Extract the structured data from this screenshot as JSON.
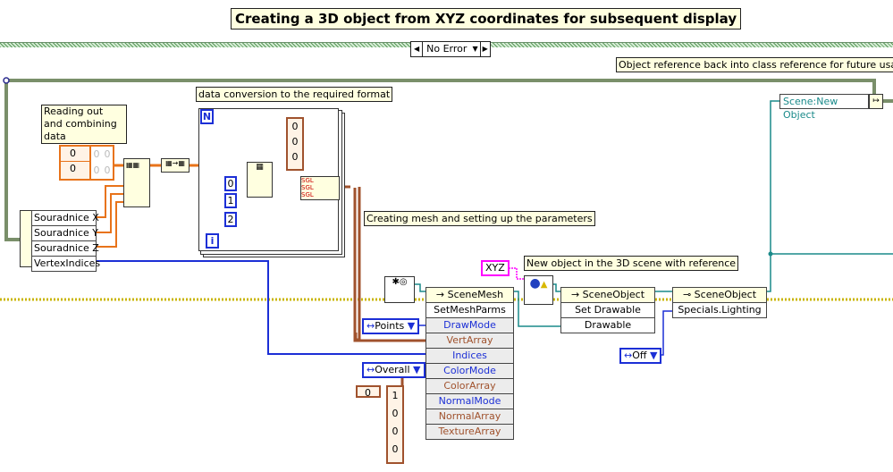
{
  "title": "Creating a 3D object from XYZ coordinates for subsequent display",
  "error_cluster": {
    "value": "No Error"
  },
  "comments": {
    "reading": "Reading out and combining data",
    "conversion": "data conversion to the required format",
    "mesh": "Creating mesh and setting up the parameters",
    "new_object": "New object in the 3D scene with reference",
    "object_ref": "Object reference back into class reference for future usage"
  },
  "unbundle": {
    "items": [
      {
        "label": "Souradnice X",
        "color": "orange"
      },
      {
        "label": "Souradnice Y",
        "color": "orange"
      },
      {
        "label": "Souradnice Z",
        "color": "orange"
      },
      {
        "label": "VertexIndices",
        "color": "blue"
      }
    ]
  },
  "array_2d_const": {
    "index0": "0",
    "index1": "0",
    "cells": [
      "0",
      "0",
      "0",
      "0"
    ]
  },
  "for_loop": {
    "count_terminal": "N",
    "iteration_terminal": "i",
    "index_constants": [
      "0",
      "1",
      "2"
    ],
    "type_labels": [
      "SGL",
      "SGL",
      "SGL"
    ],
    "array_const": [
      "0",
      "0",
      "0"
    ]
  },
  "scene_mesh": {
    "class_name": "SceneMesh",
    "method": "SetMeshParms",
    "params": [
      {
        "label": "DrawMode",
        "color": "blue"
      },
      {
        "label": "VertArray",
        "color": "brown"
      },
      {
        "label": "Indices",
        "color": "blue"
      },
      {
        "label": "ColorMode",
        "color": "blue"
      },
      {
        "label": "ColorArray",
        "color": "brown"
      },
      {
        "label": "NormalMode",
        "color": "blue"
      },
      {
        "label": "NormalArray",
        "color": "brown"
      },
      {
        "label": "TextureArray",
        "color": "brown"
      }
    ]
  },
  "enums": {
    "draw_mode": "Points",
    "color_mode": "Overall",
    "lighting": "Off"
  },
  "color_array": {
    "index": "0",
    "values": [
      "1",
      "0",
      "0",
      "0"
    ]
  },
  "xyz_const": "XYZ",
  "scene_object_method": {
    "class_name": "SceneObject",
    "method": "Set Drawable",
    "param": "Drawable"
  },
  "scene_object_prop": {
    "class_name": "SceneObject",
    "property": "Specials.Lighting"
  },
  "scene_new_object": "Scene:New Object"
}
